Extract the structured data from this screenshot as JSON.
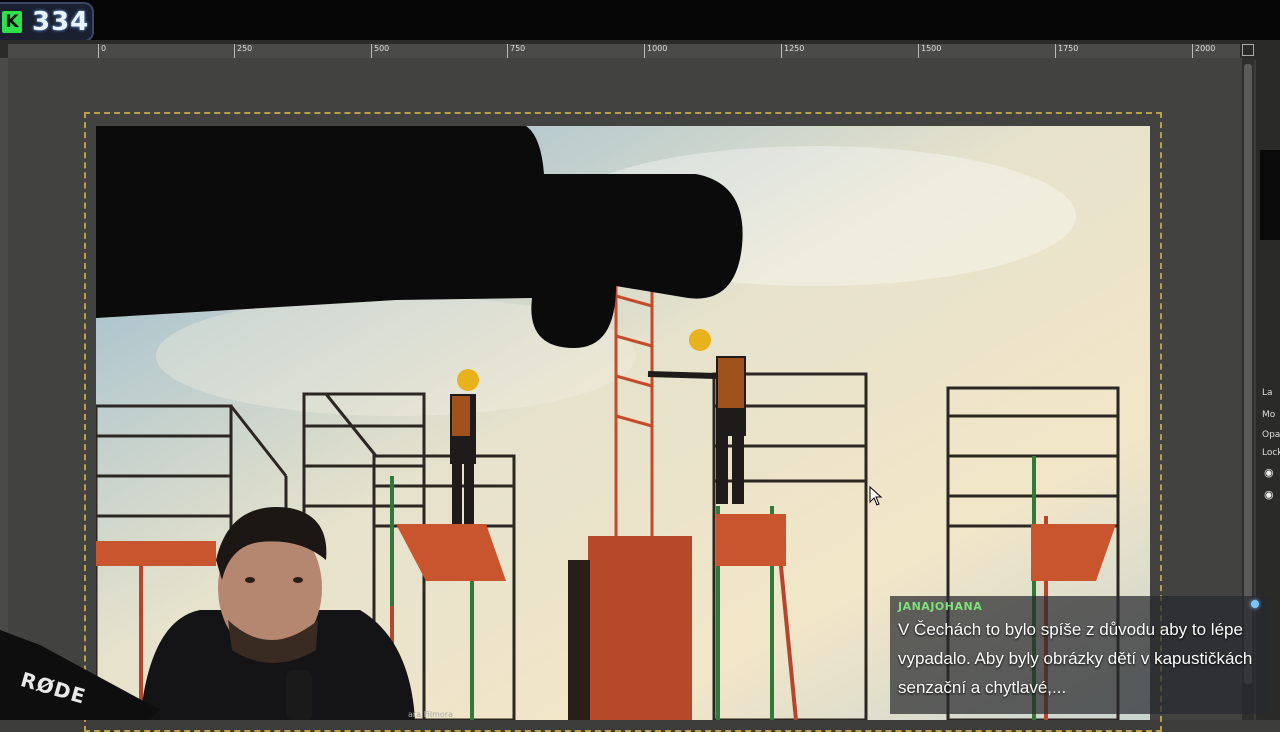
{
  "stream_badge": {
    "letter": "K",
    "count": "334",
    "accent": "#2ee04a"
  },
  "ruler": {
    "labels": [
      "0",
      "250",
      "500",
      "750",
      "1000",
      "1250",
      "1500",
      "1750",
      "2000"
    ]
  },
  "layers_panel": {
    "labels": [
      "La",
      "Mo",
      "Opa",
      "Lock:"
    ]
  },
  "chat": {
    "username": "JANAJOHANA",
    "message": "V Čechách to bylo spíše z důvodu aby to lépe vypadalo. Aby byly obrázky dětí v kapustičkách senzační a chytlavé,..."
  },
  "mic_brand": "RØDE",
  "credit_text": "ara Filmora",
  "colors": {
    "selection": "#b8a04a",
    "chat_user": "#7ee07a",
    "canvas_bg": "#424241"
  }
}
